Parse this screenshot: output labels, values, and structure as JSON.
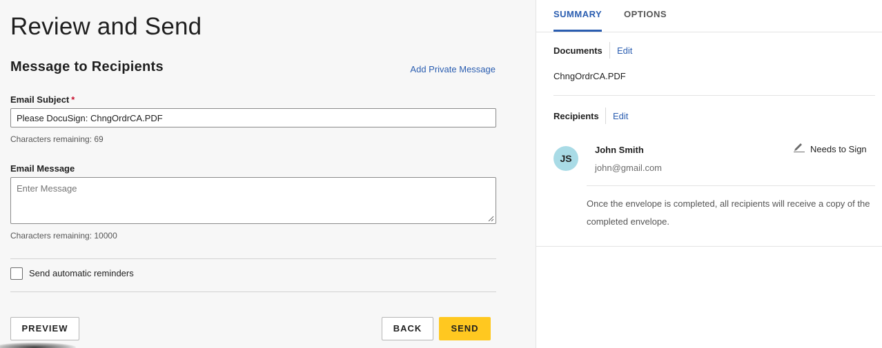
{
  "page": {
    "title": "Review and Send"
  },
  "message_section": {
    "title": "Message to Recipients",
    "add_private_message": "Add Private Message"
  },
  "email_subject": {
    "label": "Email Subject",
    "required_marker": "*",
    "value": "Please DocuSign: ChngOrdrCA.PDF",
    "hint": "Characters remaining: 69"
  },
  "email_message": {
    "label": "Email Message",
    "placeholder": "Enter Message",
    "value": "",
    "hint": "Characters remaining: 10000"
  },
  "reminders": {
    "label": "Send automatic reminders",
    "checked": false
  },
  "buttons": {
    "preview": "PREVIEW",
    "back": "BACK",
    "send": "SEND"
  },
  "tabs": [
    {
      "label": "SUMMARY",
      "active": true
    },
    {
      "label": "OPTIONS",
      "active": false
    }
  ],
  "summary": {
    "documents": {
      "label": "Documents",
      "edit": "Edit",
      "items": [
        "ChngOrdrCA.PDF"
      ]
    },
    "recipients": {
      "label": "Recipients",
      "edit": "Edit",
      "items": [
        {
          "initials": "JS",
          "name": "John Smith",
          "email": "john@gmail.com",
          "action": "Needs to Sign",
          "action_icon": "pen-icon"
        }
      ]
    },
    "note": "Once the envelope is completed, all recipients will receive a copy of the completed envelope."
  },
  "colors": {
    "accent": "#2a5db0",
    "send_button": "#ffc820",
    "avatar": "#a9dbe6",
    "left_panel_bg": "#f7f7f7",
    "required": "#c8102e"
  }
}
